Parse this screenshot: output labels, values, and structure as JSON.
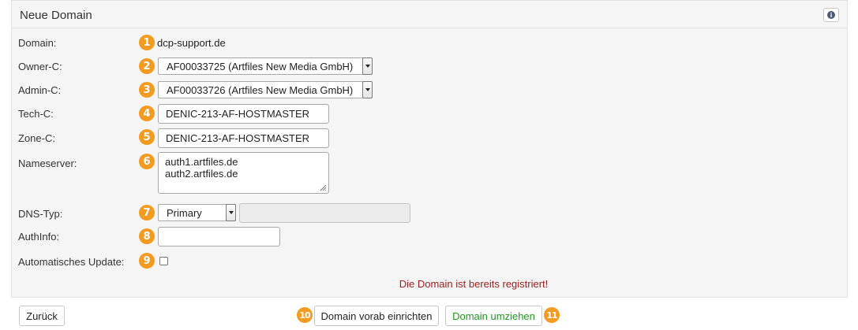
{
  "header": {
    "title": "Neue Domain",
    "info_icon": "info-icon"
  },
  "form": {
    "domain": {
      "label": "Domain:",
      "badge": "1",
      "value": "dcp-support.de"
    },
    "owner_c": {
      "label": "Owner-C:",
      "badge": "2",
      "value": "AF00033725 (Artfiles New Media GmbH)"
    },
    "admin_c": {
      "label": "Admin-C:",
      "badge": "3",
      "value": "AF00033726 (Artfiles New Media GmbH)"
    },
    "tech_c": {
      "label": "Tech-C:",
      "badge": "4",
      "value": "DENIC-213-AF-HOSTMASTER"
    },
    "zone_c": {
      "label": "Zone-C:",
      "badge": "5",
      "value": "DENIC-213-AF-HOSTMASTER"
    },
    "nameserver": {
      "label": "Nameserver:",
      "badge": "6",
      "lines": [
        "auth1.artfiles.de",
        "auth2.artfiles.de"
      ]
    },
    "dns_typ": {
      "label": "DNS-Typ:",
      "badge": "7",
      "value": "Primary",
      "extra_value": ""
    },
    "authinfo": {
      "label": "AuthInfo:",
      "badge": "8",
      "value": ""
    },
    "auto_update": {
      "label": "Automatisches Update:",
      "badge": "9",
      "checked": false
    }
  },
  "error_message": "Die Domain ist bereits registriert!",
  "buttons": {
    "back": "Zurück",
    "setup": "Domain vorab einrichten",
    "setup_badge": "10",
    "transfer": "Domain umziehen",
    "transfer_badge": "11"
  },
  "colors": {
    "badge": "#f29b20",
    "error": "#a01e1e",
    "transfer": "#1f9a1f"
  }
}
